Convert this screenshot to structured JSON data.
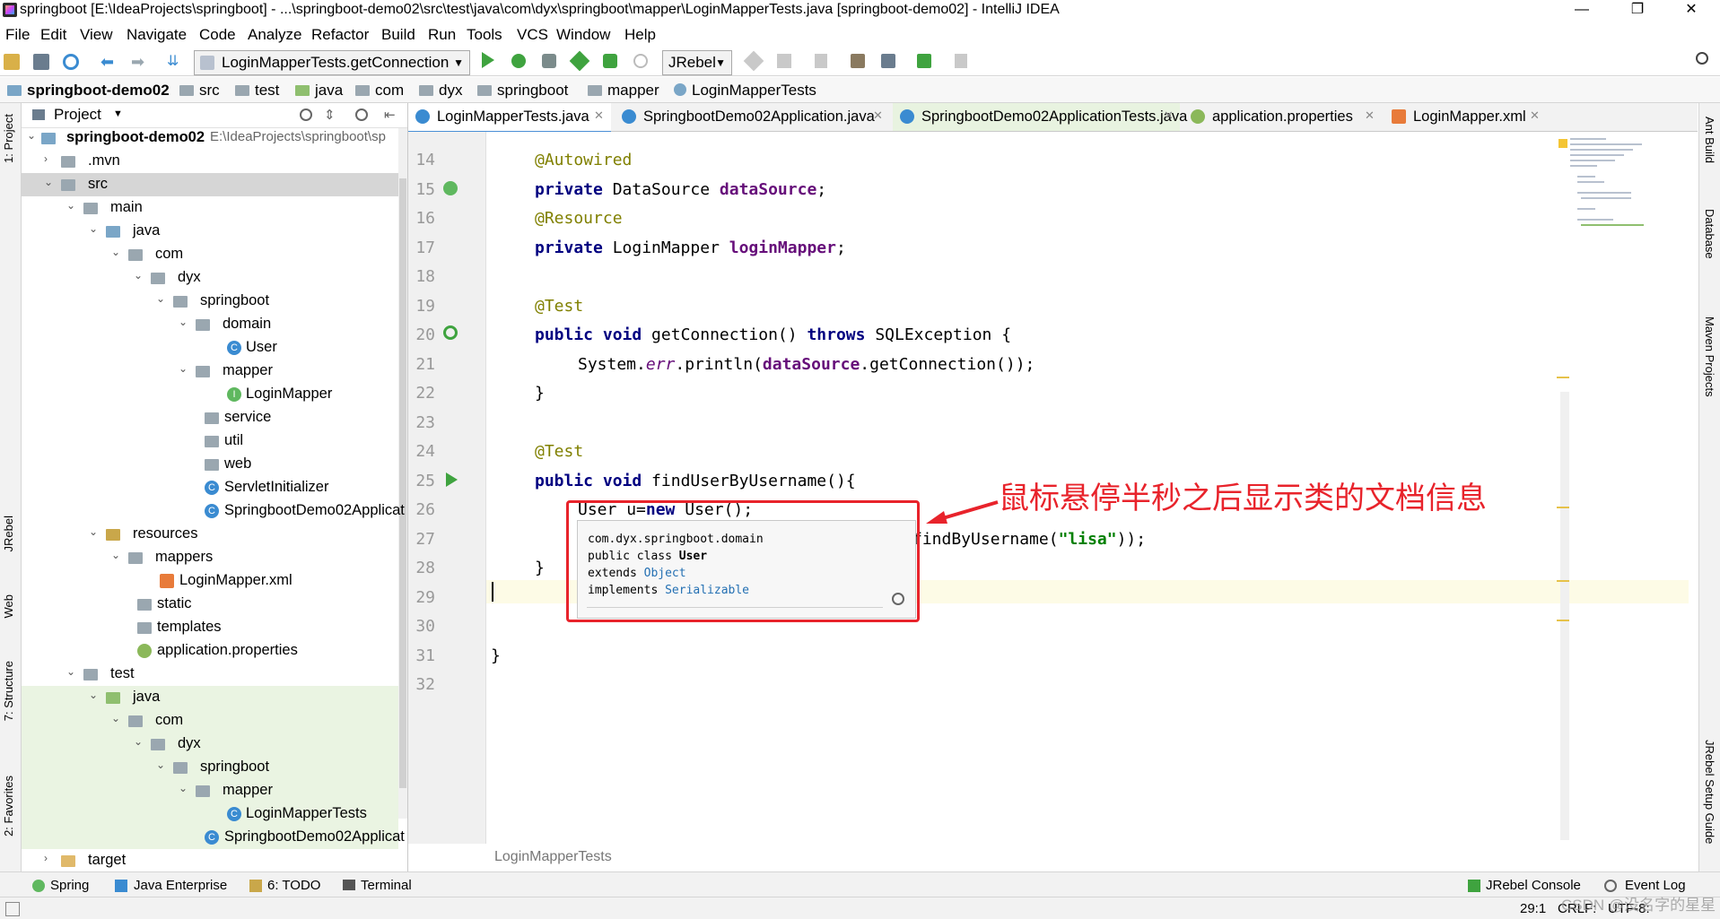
{
  "window": {
    "title": "springboot [E:\\IdeaProjects\\springboot] - ...\\springboot-demo02\\src\\test\\java\\com\\dyx\\springboot\\mapper\\LoginMapperTests.java [springboot-demo02] - IntelliJ IDEA",
    "minimize": "—",
    "maximize": "❐",
    "close": "✕"
  },
  "menu": [
    "File",
    "Edit",
    "View",
    "Navigate",
    "Code",
    "Analyze",
    "Refactor",
    "Build",
    "Run",
    "Tools",
    "VCS",
    "Window",
    "Help"
  ],
  "toolbar": {
    "run_config": "LoginMapperTests.getConnection",
    "jrebel": "JRebel"
  },
  "breadcrumb": [
    "springboot-demo02",
    "src",
    "test",
    "java",
    "com",
    "dyx",
    "springboot",
    "mapper",
    "LoginMapperTests"
  ],
  "left_stripe": [
    "1: Project",
    "JRebel",
    "Web",
    "7: Structure",
    "2: Favorites"
  ],
  "right_stripe": [
    "Ant Build",
    "Database",
    "Maven Projects",
    "JRebel Setup Guide"
  ],
  "project": {
    "header": "Project",
    "root_label": "springboot-demo02",
    "root_path": "E:\\IdeaProjects\\springboot\\sp",
    "tree": [
      {
        "label": ".mvn"
      },
      {
        "label": "src"
      },
      {
        "label": "main"
      },
      {
        "label": "java"
      },
      {
        "label": "com"
      },
      {
        "label": "dyx"
      },
      {
        "label": "springboot"
      },
      {
        "label": "domain"
      },
      {
        "label": "User"
      },
      {
        "label": "mapper"
      },
      {
        "label": "LoginMapper"
      },
      {
        "label": "service"
      },
      {
        "label": "util"
      },
      {
        "label": "web"
      },
      {
        "label": "ServletInitializer"
      },
      {
        "label": "SpringbootDemo02Applicat"
      },
      {
        "label": "resources"
      },
      {
        "label": "mappers"
      },
      {
        "label": "LoginMapper.xml"
      },
      {
        "label": "static"
      },
      {
        "label": "templates"
      },
      {
        "label": "application.properties"
      },
      {
        "label": "test"
      },
      {
        "label": "java"
      },
      {
        "label": "com"
      },
      {
        "label": "dyx"
      },
      {
        "label": "springboot"
      },
      {
        "label": "mapper"
      },
      {
        "label": "LoginMapperTests"
      },
      {
        "label": "SpringbootDemo02Applicat"
      },
      {
        "label": "target"
      }
    ]
  },
  "tabs": [
    {
      "label": "LoginMapperTests.java"
    },
    {
      "label": "SpringbootDemo02Application.java"
    },
    {
      "label": "SpringbootDemo02ApplicationTests.java"
    },
    {
      "label": "application.properties"
    },
    {
      "label": "LoginMapper.xml"
    }
  ],
  "editor": {
    "line_numbers": [
      "14",
      "15",
      "16",
      "17",
      "18",
      "19",
      "20",
      "21",
      "22",
      "23",
      "24",
      "25",
      "26",
      "27",
      "28",
      "29",
      "30",
      "31",
      "32"
    ],
    "bottom_label": "LoginMapperTests"
  },
  "popup": {
    "package": "com.dyx.springboot.domain",
    "decl_prefix": "public class ",
    "class_name": "User",
    "extends_prefix": "extends ",
    "extends_link": "Object",
    "implements_prefix": "implements ",
    "implements_link": "Serializable"
  },
  "annotation": "鼠标悬停半秒之后显示类的文档信息",
  "bottom_tools": [
    "Spring",
    "Java Enterprise",
    "6: TODO",
    "Terminal",
    "JRebel Console",
    "Event Log"
  ],
  "status": {
    "position": "29:1",
    "line_sep": "CRLF:",
    "encoding": "UTF-8:",
    "watermark": "CSDN @没名字的星星"
  },
  "colors": {
    "annotation_red": "#e8232b",
    "keyword": "#000080",
    "field": "#660e7a",
    "string": "#008000",
    "annotation_java": "#808000"
  }
}
